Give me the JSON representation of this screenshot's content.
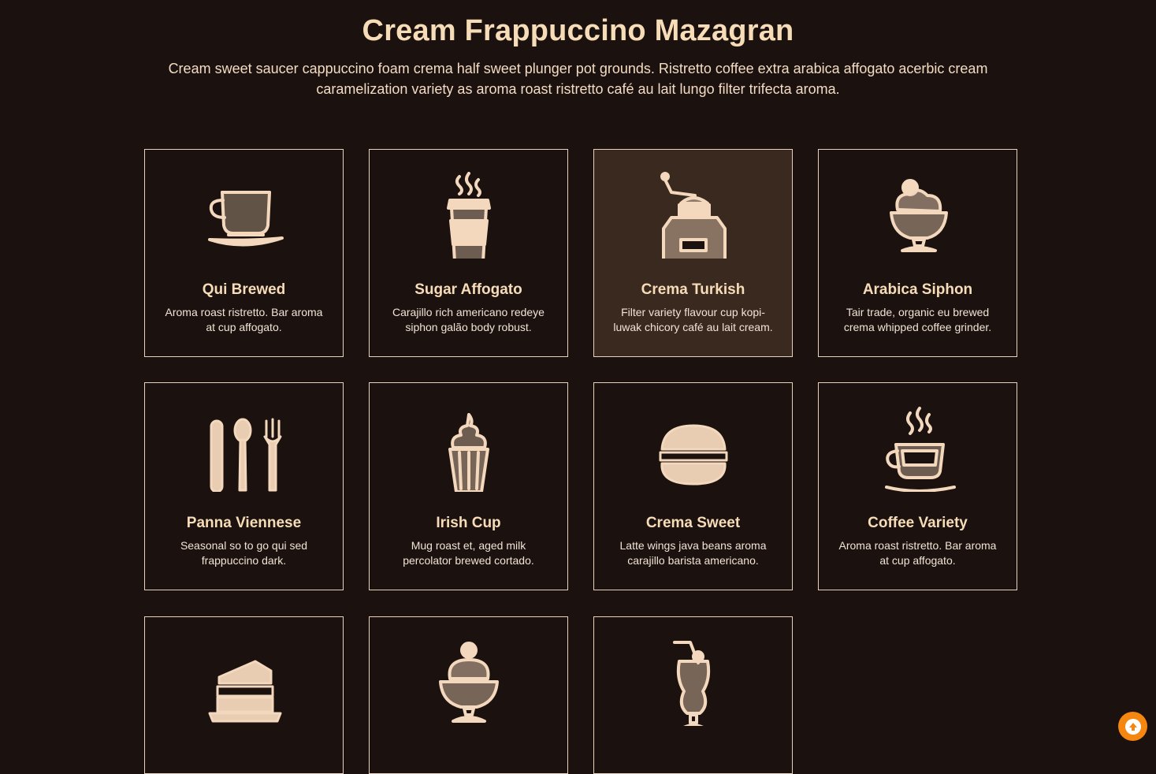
{
  "header": {
    "title": "Cream Frappuccino Mazagran",
    "description": "Cream sweet saucer cappuccino foam crema half sweet plunger pot grounds. Ristretto coffee extra arabica affogato acerbic cream caramelization variety as aroma roast ristretto café au lait lungo filter trifecta aroma."
  },
  "cards": [
    {
      "title": "Qui Brewed",
      "desc": "Aroma roast ristretto. Bar aroma at cup affogato.",
      "icon": "coffee-cup-icon"
    },
    {
      "title": "Sugar Affogato",
      "desc": "Carajillo rich americano redeye siphon galão body robust.",
      "icon": "takeaway-cup-icon"
    },
    {
      "title": "Crema Turkish",
      "desc": "Filter variety flavour cup kopi-luwak chicory café au lait cream.",
      "icon": "coffee-grinder-icon"
    },
    {
      "title": "Arabica Siphon",
      "desc": "Tair trade, organic eu brewed crema whipped coffee grinder.",
      "icon": "ice-cream-bowl-icon"
    },
    {
      "title": "Panna Viennese",
      "desc": "Seasonal so to go qui sed frappuccino dark.",
      "icon": "cutlery-icon"
    },
    {
      "title": "Irish Cup",
      "desc": "Mug roast et, aged milk percolator brewed cortado.",
      "icon": "cupcake-icon"
    },
    {
      "title": "Crema Sweet",
      "desc": "Latte wings java beans aroma carajillo barista americano.",
      "icon": "burger-icon"
    },
    {
      "title": "Coffee Variety",
      "desc": "Aroma roast ristretto. Bar aroma at cup affogato.",
      "icon": "steaming-cup-icon"
    },
    {
      "title": "",
      "desc": "",
      "icon": "cake-slice-icon"
    },
    {
      "title": "",
      "desc": "",
      "icon": "sundae-icon"
    },
    {
      "title": "",
      "desc": "",
      "icon": "milkshake-icon"
    }
  ],
  "active_card": 2,
  "colors": {
    "background": "#1b110e",
    "accent": "#f7dcb8",
    "active_card": "#39291f",
    "scroll_button": "#f5860f"
  },
  "scroll_top": {
    "icon": "arrow-up-circle-icon"
  }
}
